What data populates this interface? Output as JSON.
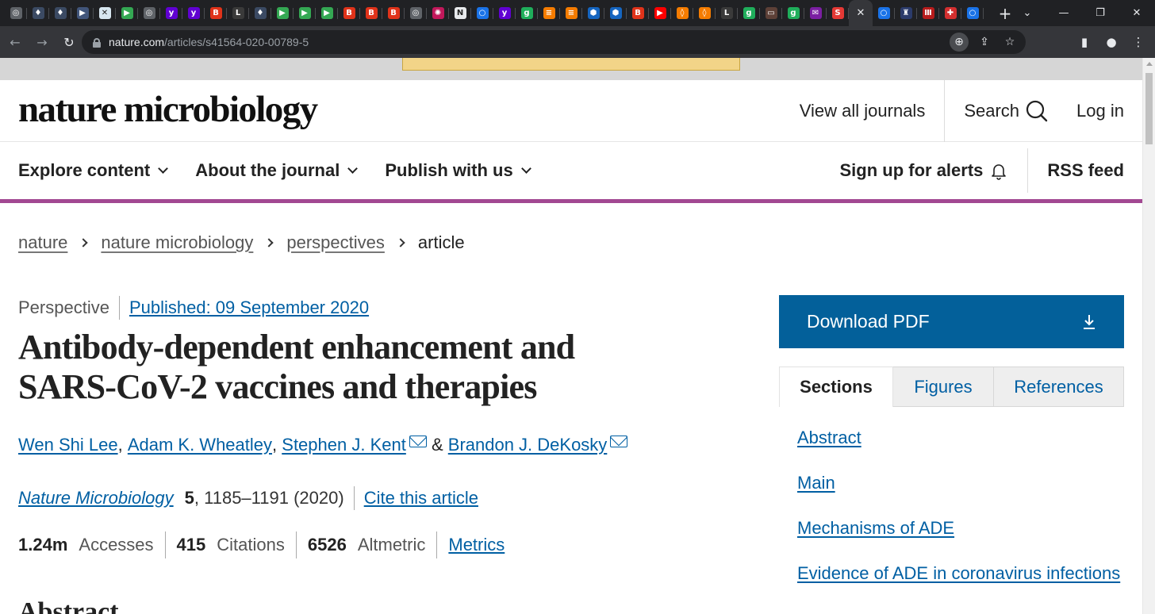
{
  "browser": {
    "url_host": "nature.com",
    "url_path": "/articles/s41564-020-00789-5",
    "tab_favicons": [
      {
        "icon": "chrome-icon",
        "bg": "#5f6368",
        "glyph": "◎"
      },
      {
        "icon": "shield-icon",
        "bg": "#3b4a63",
        "glyph": "♦"
      },
      {
        "icon": "shield-icon",
        "bg": "#3b4a63",
        "glyph": "♦"
      },
      {
        "icon": "arrow-icon",
        "bg": "#41557a",
        "glyph": "▶"
      },
      {
        "icon": "grid-icon",
        "bg": "#d7e6f0",
        "glyph": "✕"
      },
      {
        "icon": "play-icon",
        "bg": "#34a853",
        "glyph": "▶"
      },
      {
        "icon": "globe-icon",
        "bg": "#5f6368",
        "glyph": "◎"
      },
      {
        "icon": "yahoo-icon",
        "bg": "#6001d2",
        "glyph": "y"
      },
      {
        "icon": "yahoo-icon",
        "bg": "#6001d2",
        "glyph": "y"
      },
      {
        "icon": "bi-icon",
        "bg": "#e0331a",
        "glyph": "B"
      },
      {
        "icon": "lit-icon",
        "bg": "#3a3a3a",
        "glyph": "L"
      },
      {
        "icon": "shield-icon",
        "bg": "#3b4a63",
        "glyph": "♦"
      },
      {
        "icon": "play-icon",
        "bg": "#34a853",
        "glyph": "▶"
      },
      {
        "icon": "play-icon",
        "bg": "#34a853",
        "glyph": "▶"
      },
      {
        "icon": "play-icon",
        "bg": "#34a853",
        "glyph": "▶"
      },
      {
        "icon": "bi-icon",
        "bg": "#e0331a",
        "glyph": "B"
      },
      {
        "icon": "bi-icon",
        "bg": "#e0331a",
        "glyph": "B"
      },
      {
        "icon": "bi-icon",
        "bg": "#e0331a",
        "glyph": "B"
      },
      {
        "icon": "globe-icon",
        "bg": "#5f6368",
        "glyph": "◎"
      },
      {
        "icon": "burst-icon",
        "bg": "#c2185b",
        "glyph": "✺"
      },
      {
        "icon": "news-icon",
        "bg": "#e8eaed",
        "glyph": "N"
      },
      {
        "icon": "search-icon",
        "bg": "#1a73e8",
        "glyph": "○"
      },
      {
        "icon": "yahoo-icon",
        "bg": "#6001d2",
        "glyph": "y"
      },
      {
        "icon": "g-icon",
        "bg": "#1fae5b",
        "glyph": "g"
      },
      {
        "icon": "bookmark-icon",
        "bg": "#f57c00",
        "glyph": "≡"
      },
      {
        "icon": "bookmark-icon",
        "bg": "#f57c00",
        "glyph": "≡"
      },
      {
        "icon": "hex-icon",
        "bg": "#1565c0",
        "glyph": "⬢"
      },
      {
        "icon": "hex-icon",
        "bg": "#1565c0",
        "glyph": "⬢"
      },
      {
        "icon": "bi-icon",
        "bg": "#e0331a",
        "glyph": "B"
      },
      {
        "icon": "youtube-icon",
        "bg": "#ff0000",
        "glyph": "▶"
      },
      {
        "icon": "shield-icon",
        "bg": "#f57c00",
        "glyph": "◊"
      },
      {
        "icon": "shield-icon",
        "bg": "#f57c00",
        "glyph": "◊"
      },
      {
        "icon": "lit-icon",
        "bg": "#3a3a3a",
        "glyph": "L"
      },
      {
        "icon": "g-icon",
        "bg": "#1fae5b",
        "glyph": "g"
      },
      {
        "icon": "tv-icon",
        "bg": "#5d4037",
        "glyph": "▭"
      },
      {
        "icon": "g-icon",
        "bg": "#1fae5b",
        "glyph": "g"
      },
      {
        "icon": "mail-icon",
        "bg": "#7b1fa2",
        "glyph": "✉"
      },
      {
        "icon": "s-icon",
        "bg": "#e53935",
        "glyph": "S"
      }
    ],
    "tab_favicons_after": [
      {
        "icon": "search-icon",
        "bg": "#1a73e8",
        "glyph": "○"
      },
      {
        "icon": "crest-icon",
        "bg": "#2b3b6b",
        "glyph": "♜"
      },
      {
        "icon": "columns-icon",
        "bg": "#b71c1c",
        "glyph": "Ⅲ"
      },
      {
        "icon": "pin-icon",
        "bg": "#d32f2f",
        "glyph": "✚"
      },
      {
        "icon": "search-icon",
        "bg": "#1a73e8",
        "glyph": "○"
      }
    ],
    "active_tab_close": "✕",
    "new_tab": "+"
  },
  "site": {
    "brand": "nature microbiology",
    "view_all_journals": "View all journals",
    "search": "Search",
    "login": "Log in",
    "accent": "#a24892"
  },
  "nav": {
    "explore": "Explore content",
    "about": "About the journal",
    "publish": "Publish with us",
    "alerts": "Sign up for alerts",
    "rss": "RSS feed"
  },
  "breadcrumbs": [
    "nature",
    "nature microbiology",
    "perspectives",
    "article"
  ],
  "article": {
    "type": "Perspective",
    "published": "Published: 09 September 2020",
    "title": "Antibody-dependent enhancement and SARS-CoV-2 vaccines and therapies",
    "authors": [
      "Wen Shi Lee",
      "Adam K. Wheatley",
      "Stephen J. Kent",
      "Brandon J. DeKosky"
    ],
    "sep_comma": ",",
    "sep_and": "&",
    "journal": "Nature Microbiology",
    "volume": "5",
    "pages": ", 1185–1191 (2020)",
    "cite": "Cite this article",
    "accesses_value": "1.24m",
    "accesses_label": "Accesses",
    "citations_value": "415",
    "citations_label": "Citations",
    "altmetric_value": "6526",
    "altmetric_label": "Altmetric",
    "metrics_link": "Metrics",
    "abstract_heading": "Abstract"
  },
  "sidebar": {
    "download": "Download PDF",
    "tabs": [
      "Sections",
      "Figures",
      "References"
    ],
    "sections": [
      "Abstract",
      "Main",
      "Mechanisms of ADE",
      "Evidence of ADE in coronavirus infections"
    ],
    "download_color": "#03609a"
  }
}
